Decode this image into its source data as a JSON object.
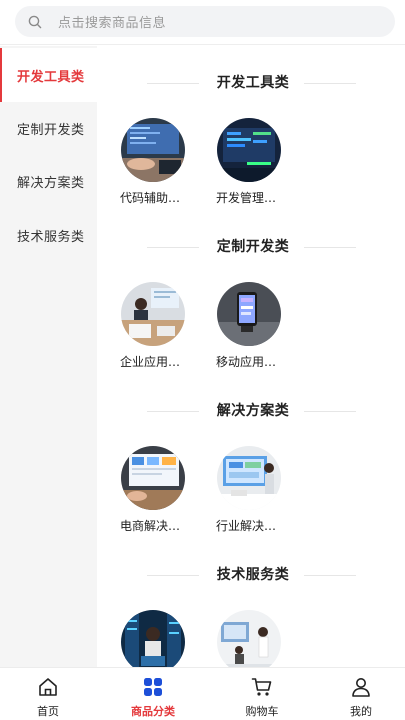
{
  "search": {
    "placeholder": "点击搜索商品信息"
  },
  "sidebar": {
    "items": [
      {
        "label": "开发工具类",
        "active": true
      },
      {
        "label": "定制开发类",
        "active": false
      },
      {
        "label": "解决方案类",
        "active": false
      },
      {
        "label": "技术服务类",
        "active": false
      }
    ]
  },
  "sections": [
    {
      "title": "开发工具类",
      "items": [
        {
          "label": "代码辅助…",
          "image": "code-assist-photo"
        },
        {
          "label": "开发管理…",
          "image": "dev-management-photo"
        }
      ]
    },
    {
      "title": "定制开发类",
      "items": [
        {
          "label": "企业应用…",
          "image": "enterprise-app-photo"
        },
        {
          "label": "移动应用…",
          "image": "mobile-app-photo"
        }
      ]
    },
    {
      "title": "解决方案类",
      "items": [
        {
          "label": "电商解决…",
          "image": "ecommerce-solution-photo"
        },
        {
          "label": "行业解决…",
          "image": "industry-solution-photo"
        }
      ]
    },
    {
      "title": "技术服务类",
      "items": [
        {
          "label": "",
          "image": "server-ops-photo"
        },
        {
          "label": "",
          "image": "tech-consulting-photo"
        }
      ]
    }
  ],
  "tabbar": {
    "items": [
      {
        "label": "首页",
        "icon": "home-icon",
        "active": false
      },
      {
        "label": "商品分类",
        "icon": "category-icon",
        "active": true
      },
      {
        "label": "购物车",
        "icon": "cart-icon",
        "active": false
      },
      {
        "label": "我的",
        "icon": "user-icon",
        "active": false
      }
    ]
  },
  "colors": {
    "accent": "#e4393c",
    "sidebar_bg": "#f5f5f5",
    "search_bg": "#f2f3f5"
  }
}
